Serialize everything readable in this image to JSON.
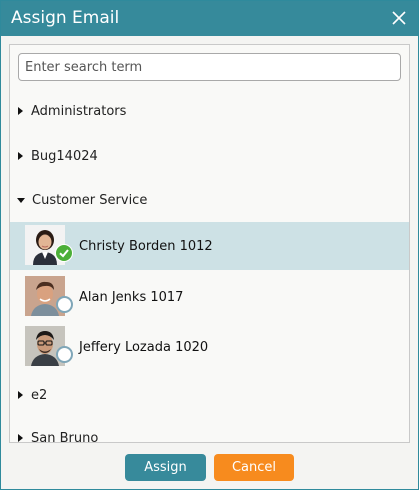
{
  "dialog": {
    "title": "Assign Email",
    "close_icon": "close-icon",
    "accent": "#368a9b"
  },
  "search": {
    "placeholder": "Enter search term",
    "value": ""
  },
  "groups": [
    {
      "label": "Administrators",
      "expanded": false
    },
    {
      "label": "Bug14024",
      "expanded": false
    },
    {
      "label": "Customer Service",
      "expanded": true,
      "users": [
        {
          "name": "Christy Borden 1012",
          "selected": true,
          "avatar_icon": "woman-avatar"
        },
        {
          "name": "Alan Jenks 1017",
          "selected": false,
          "avatar_icon": "man-avatar"
        },
        {
          "name": "Jeffery Lozada 1020",
          "selected": false,
          "avatar_icon": "man-glasses-avatar"
        }
      ]
    },
    {
      "label": "e2",
      "expanded": false
    },
    {
      "label": "San Bruno",
      "expanded": false
    }
  ],
  "buttons": {
    "assign_label": "Assign",
    "cancel_label": "Cancel",
    "assign_color": "#378a9b",
    "cancel_color": "#f78b1e"
  },
  "colors": {
    "selected_row": "#cde1e5",
    "check_green": "#4caf38"
  }
}
